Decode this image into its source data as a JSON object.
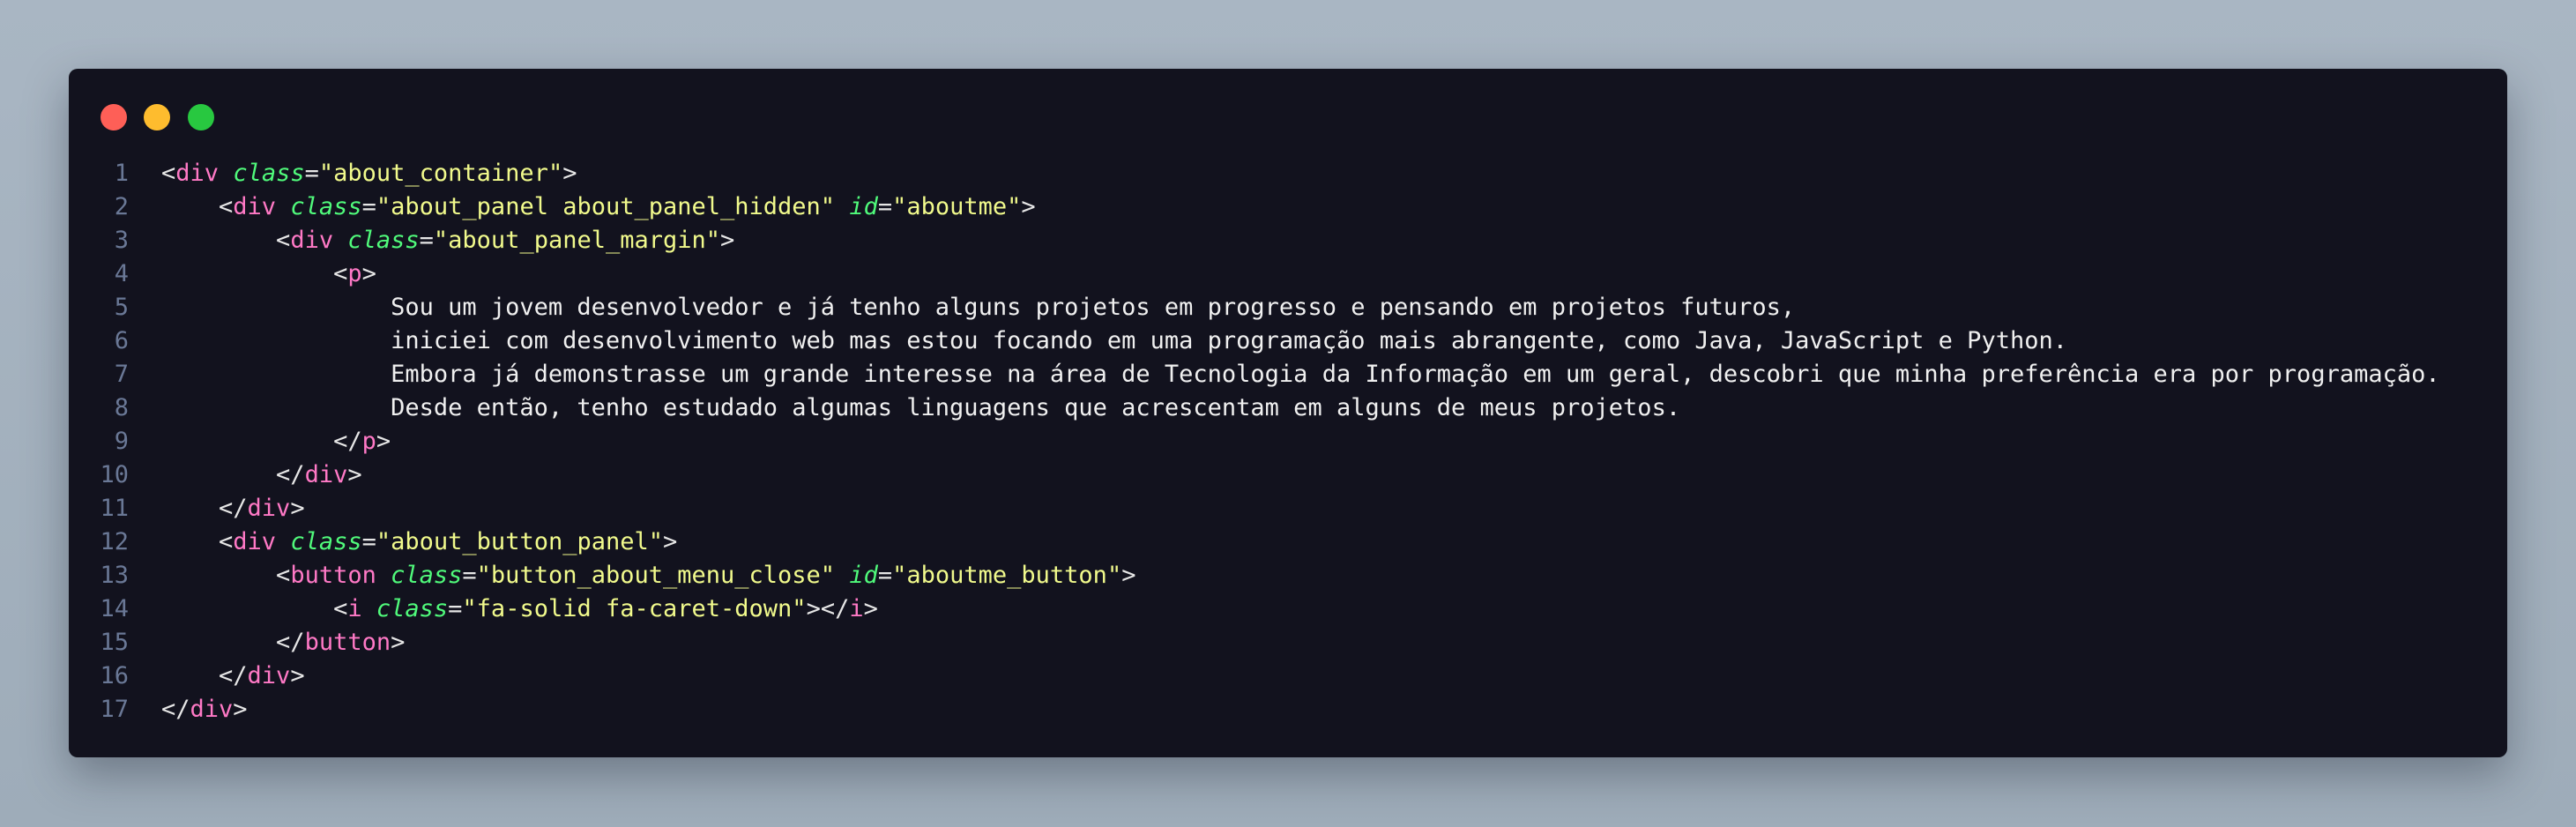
{
  "window": {
    "controls": [
      "close",
      "minimize",
      "maximize"
    ],
    "colors": {
      "close": "#fe5f57",
      "minimize": "#febc2e",
      "maximize": "#28c840",
      "background": "#12121e",
      "tag": "#ff79c6",
      "attribute": "#50fa7b",
      "string": "#f1fa8c",
      "line_number": "#6a7896"
    }
  },
  "code": {
    "lines": [
      {
        "n": "1",
        "indent": "",
        "tokens": [
          [
            "punc",
            "<"
          ],
          [
            "tag",
            "div"
          ],
          [
            "punc",
            " "
          ],
          [
            "attr",
            "class"
          ],
          [
            "punc",
            "="
          ],
          [
            "str",
            "\"about_container\""
          ],
          [
            "punc",
            ">"
          ]
        ]
      },
      {
        "n": "2",
        "indent": "    ",
        "tokens": [
          [
            "punc",
            "<"
          ],
          [
            "tag",
            "div"
          ],
          [
            "punc",
            " "
          ],
          [
            "attr",
            "class"
          ],
          [
            "punc",
            "="
          ],
          [
            "str",
            "\"about_panel about_panel_hidden\""
          ],
          [
            "punc",
            " "
          ],
          [
            "attr",
            "id"
          ],
          [
            "punc",
            "="
          ],
          [
            "str",
            "\"aboutme\""
          ],
          [
            "punc",
            ">"
          ]
        ]
      },
      {
        "n": "3",
        "indent": "        ",
        "tokens": [
          [
            "punc",
            "<"
          ],
          [
            "tag",
            "div"
          ],
          [
            "punc",
            " "
          ],
          [
            "attr",
            "class"
          ],
          [
            "punc",
            "="
          ],
          [
            "str",
            "\"about_panel_margin\""
          ],
          [
            "punc",
            ">"
          ]
        ]
      },
      {
        "n": "4",
        "indent": "            ",
        "tokens": [
          [
            "punc",
            "<"
          ],
          [
            "tag",
            "p"
          ],
          [
            "punc",
            ">"
          ]
        ]
      },
      {
        "n": "5",
        "indent": "                ",
        "tokens": [
          [
            "txt",
            "Sou um jovem desenvolvedor e já tenho alguns projetos em progresso e pensando em projetos futuros,"
          ]
        ]
      },
      {
        "n": "6",
        "indent": "                ",
        "tokens": [
          [
            "txt",
            "iniciei com desenvolvimento web mas estou focando em uma programação mais abrangente, como Java, JavaScript e Python."
          ]
        ]
      },
      {
        "n": "7",
        "indent": "                ",
        "tokens": [
          [
            "txt",
            "Embora já demonstrasse um grande interesse na área de Tecnologia da Informação em um geral, descobri que minha preferência era por programação."
          ]
        ]
      },
      {
        "n": "8",
        "indent": "                ",
        "tokens": [
          [
            "txt",
            "Desde então, tenho estudado algumas linguagens que acrescentam em alguns de meus projetos."
          ]
        ]
      },
      {
        "n": "9",
        "indent": "            ",
        "tokens": [
          [
            "punc",
            "</"
          ],
          [
            "tag",
            "p"
          ],
          [
            "punc",
            ">"
          ]
        ]
      },
      {
        "n": "10",
        "indent": "        ",
        "tokens": [
          [
            "punc",
            "</"
          ],
          [
            "tag",
            "div"
          ],
          [
            "punc",
            ">"
          ]
        ]
      },
      {
        "n": "11",
        "indent": "    ",
        "tokens": [
          [
            "punc",
            "</"
          ],
          [
            "tag",
            "div"
          ],
          [
            "punc",
            ">"
          ]
        ]
      },
      {
        "n": "12",
        "indent": "    ",
        "tokens": [
          [
            "punc",
            "<"
          ],
          [
            "tag",
            "div"
          ],
          [
            "punc",
            " "
          ],
          [
            "attr",
            "class"
          ],
          [
            "punc",
            "="
          ],
          [
            "str",
            "\"about_button_panel\""
          ],
          [
            "punc",
            ">"
          ]
        ]
      },
      {
        "n": "13",
        "indent": "        ",
        "tokens": [
          [
            "punc",
            "<"
          ],
          [
            "tag",
            "button"
          ],
          [
            "punc",
            " "
          ],
          [
            "attr",
            "class"
          ],
          [
            "punc",
            "="
          ],
          [
            "str",
            "\"button_about_menu_close\""
          ],
          [
            "punc",
            " "
          ],
          [
            "attr",
            "id"
          ],
          [
            "punc",
            "="
          ],
          [
            "str",
            "\"aboutme_button\""
          ],
          [
            "punc",
            ">"
          ]
        ]
      },
      {
        "n": "14",
        "indent": "            ",
        "tokens": [
          [
            "punc",
            "<"
          ],
          [
            "tag",
            "i"
          ],
          [
            "punc",
            " "
          ],
          [
            "attr",
            "class"
          ],
          [
            "punc",
            "="
          ],
          [
            "str",
            "\"fa-solid fa-caret-down\""
          ],
          [
            "punc",
            "></"
          ],
          [
            "tag",
            "i"
          ],
          [
            "punc",
            ">"
          ]
        ]
      },
      {
        "n": "15",
        "indent": "        ",
        "tokens": [
          [
            "punc",
            "</"
          ],
          [
            "tag",
            "button"
          ],
          [
            "punc",
            ">"
          ]
        ]
      },
      {
        "n": "16",
        "indent": "    ",
        "tokens": [
          [
            "punc",
            "</"
          ],
          [
            "tag",
            "div"
          ],
          [
            "punc",
            ">"
          ]
        ]
      },
      {
        "n": "17",
        "indent": "",
        "tokens": [
          [
            "punc",
            "</"
          ],
          [
            "tag",
            "div"
          ],
          [
            "punc",
            ">"
          ]
        ]
      }
    ]
  }
}
